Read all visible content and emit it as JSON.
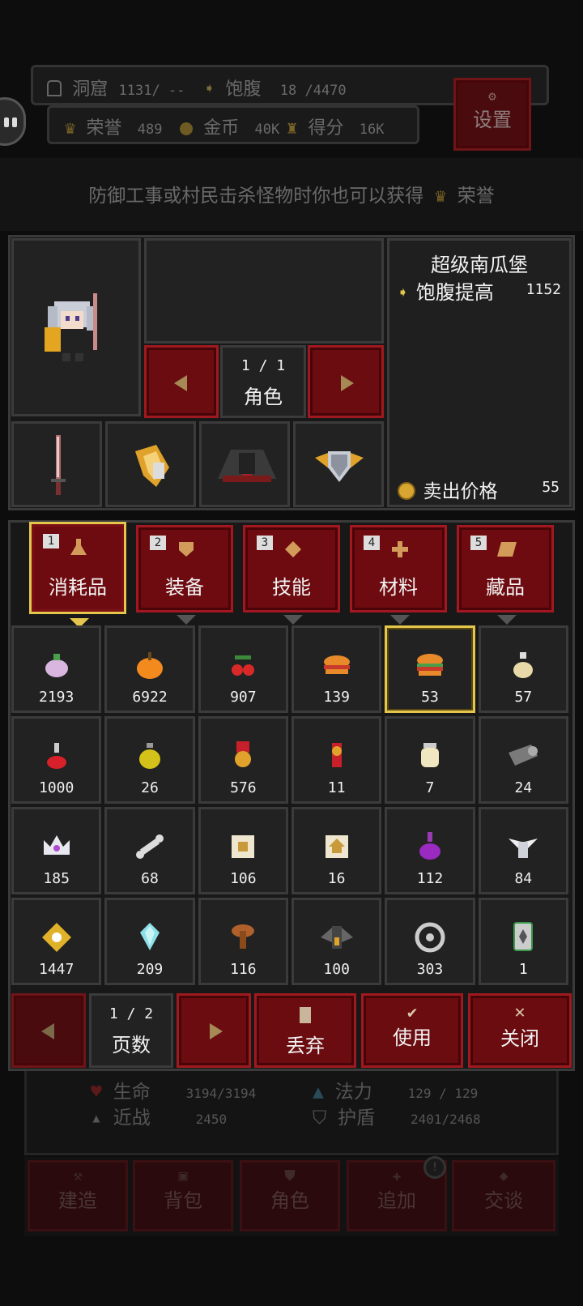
{
  "topbar": {
    "cave_label": "洞窟",
    "cave_value": "1131/ --",
    "satiety_label": "饱腹",
    "satiety_value": "18 /4470",
    "honor_label": "荣誉",
    "honor_value": "489",
    "gold_label": "金币",
    "gold_value": "40K",
    "score_label": "得分",
    "score_value": "16K",
    "settings_label": "设置"
  },
  "hint": {
    "text": "防御工事或村民击杀怪物时你也可以获得",
    "honor_label": "荣誉"
  },
  "character": {
    "page": "1 / 1",
    "page_label": "角色"
  },
  "detail": {
    "item_name": "超级南瓜堡",
    "effect_label": "饱腹提高",
    "effect_value": "1152",
    "sell_label": "卖出价格",
    "sell_value": "55"
  },
  "tabs": [
    {
      "num": "1",
      "label": "消耗品",
      "icon": "flask-icon"
    },
    {
      "num": "2",
      "label": "装备",
      "icon": "shield-icon"
    },
    {
      "num": "3",
      "label": "技能",
      "icon": "diamond-icon"
    },
    {
      "num": "4",
      "label": "材料",
      "icon": "cross-icon"
    },
    {
      "num": "5",
      "label": "藏品",
      "icon": "scroll-icon"
    }
  ],
  "items": [
    {
      "count": "2193",
      "icon": "turnip-icon"
    },
    {
      "count": "6922",
      "icon": "pumpkin-icon"
    },
    {
      "count": "907",
      "icon": "cherries-icon"
    },
    {
      "count": "139",
      "icon": "burger-icon"
    },
    {
      "count": "53",
      "icon": "pumpkin-burger-icon",
      "selected": true
    },
    {
      "count": "57",
      "icon": "potion-bottle-icon"
    },
    {
      "count": "1000",
      "icon": "red-potion-icon"
    },
    {
      "count": "26",
      "icon": "yellow-potion-icon"
    },
    {
      "count": "576",
      "icon": "medal-icon"
    },
    {
      "count": "11",
      "icon": "sword-banner-icon"
    },
    {
      "count": "7",
      "icon": "jar-icon"
    },
    {
      "count": "24",
      "icon": "cloth-roll-icon"
    },
    {
      "count": "185",
      "icon": "crown-icon"
    },
    {
      "count": "68",
      "icon": "bone-icon"
    },
    {
      "count": "106",
      "icon": "scroll-house-icon"
    },
    {
      "count": "16",
      "icon": "scroll-house-2-icon"
    },
    {
      "count": "112",
      "icon": "purple-potion-icon"
    },
    {
      "count": "84",
      "icon": "winged-statue-icon"
    },
    {
      "count": "1447",
      "icon": "gold-star-icon"
    },
    {
      "count": "209",
      "icon": "crystal-icon"
    },
    {
      "count": "116",
      "icon": "tree-icon"
    },
    {
      "count": "100",
      "icon": "bat-shrine-icon"
    },
    {
      "count": "303",
      "icon": "gear-ring-icon"
    },
    {
      "count": "1",
      "icon": "card-icon"
    }
  ],
  "bottombar": {
    "page": "1 / 2",
    "page_label": "页数",
    "discard_label": "丢弃",
    "use_label": "使用",
    "close_label": "关闭"
  },
  "stats": {
    "hp_label": "生命",
    "hp_value": "3194/3194",
    "mp_label": "法力",
    "mp_value": "129 / 129",
    "melee_label": "近战",
    "melee_value": "2450",
    "shield_label": "护盾",
    "shield_value": "2401/2468"
  },
  "nav": [
    {
      "label": "建造",
      "icon": "hammer-icon"
    },
    {
      "label": "背包",
      "icon": "bag-icon"
    },
    {
      "label": "角色",
      "icon": "armor-icon"
    },
    {
      "label": "追加",
      "icon": "plus-icon"
    },
    {
      "label": "交谈",
      "icon": "chat-icon"
    }
  ],
  "colors": {
    "accent_red": "#6b0c10",
    "gold": "#e5c64c",
    "panel": "#1e1e1e"
  }
}
